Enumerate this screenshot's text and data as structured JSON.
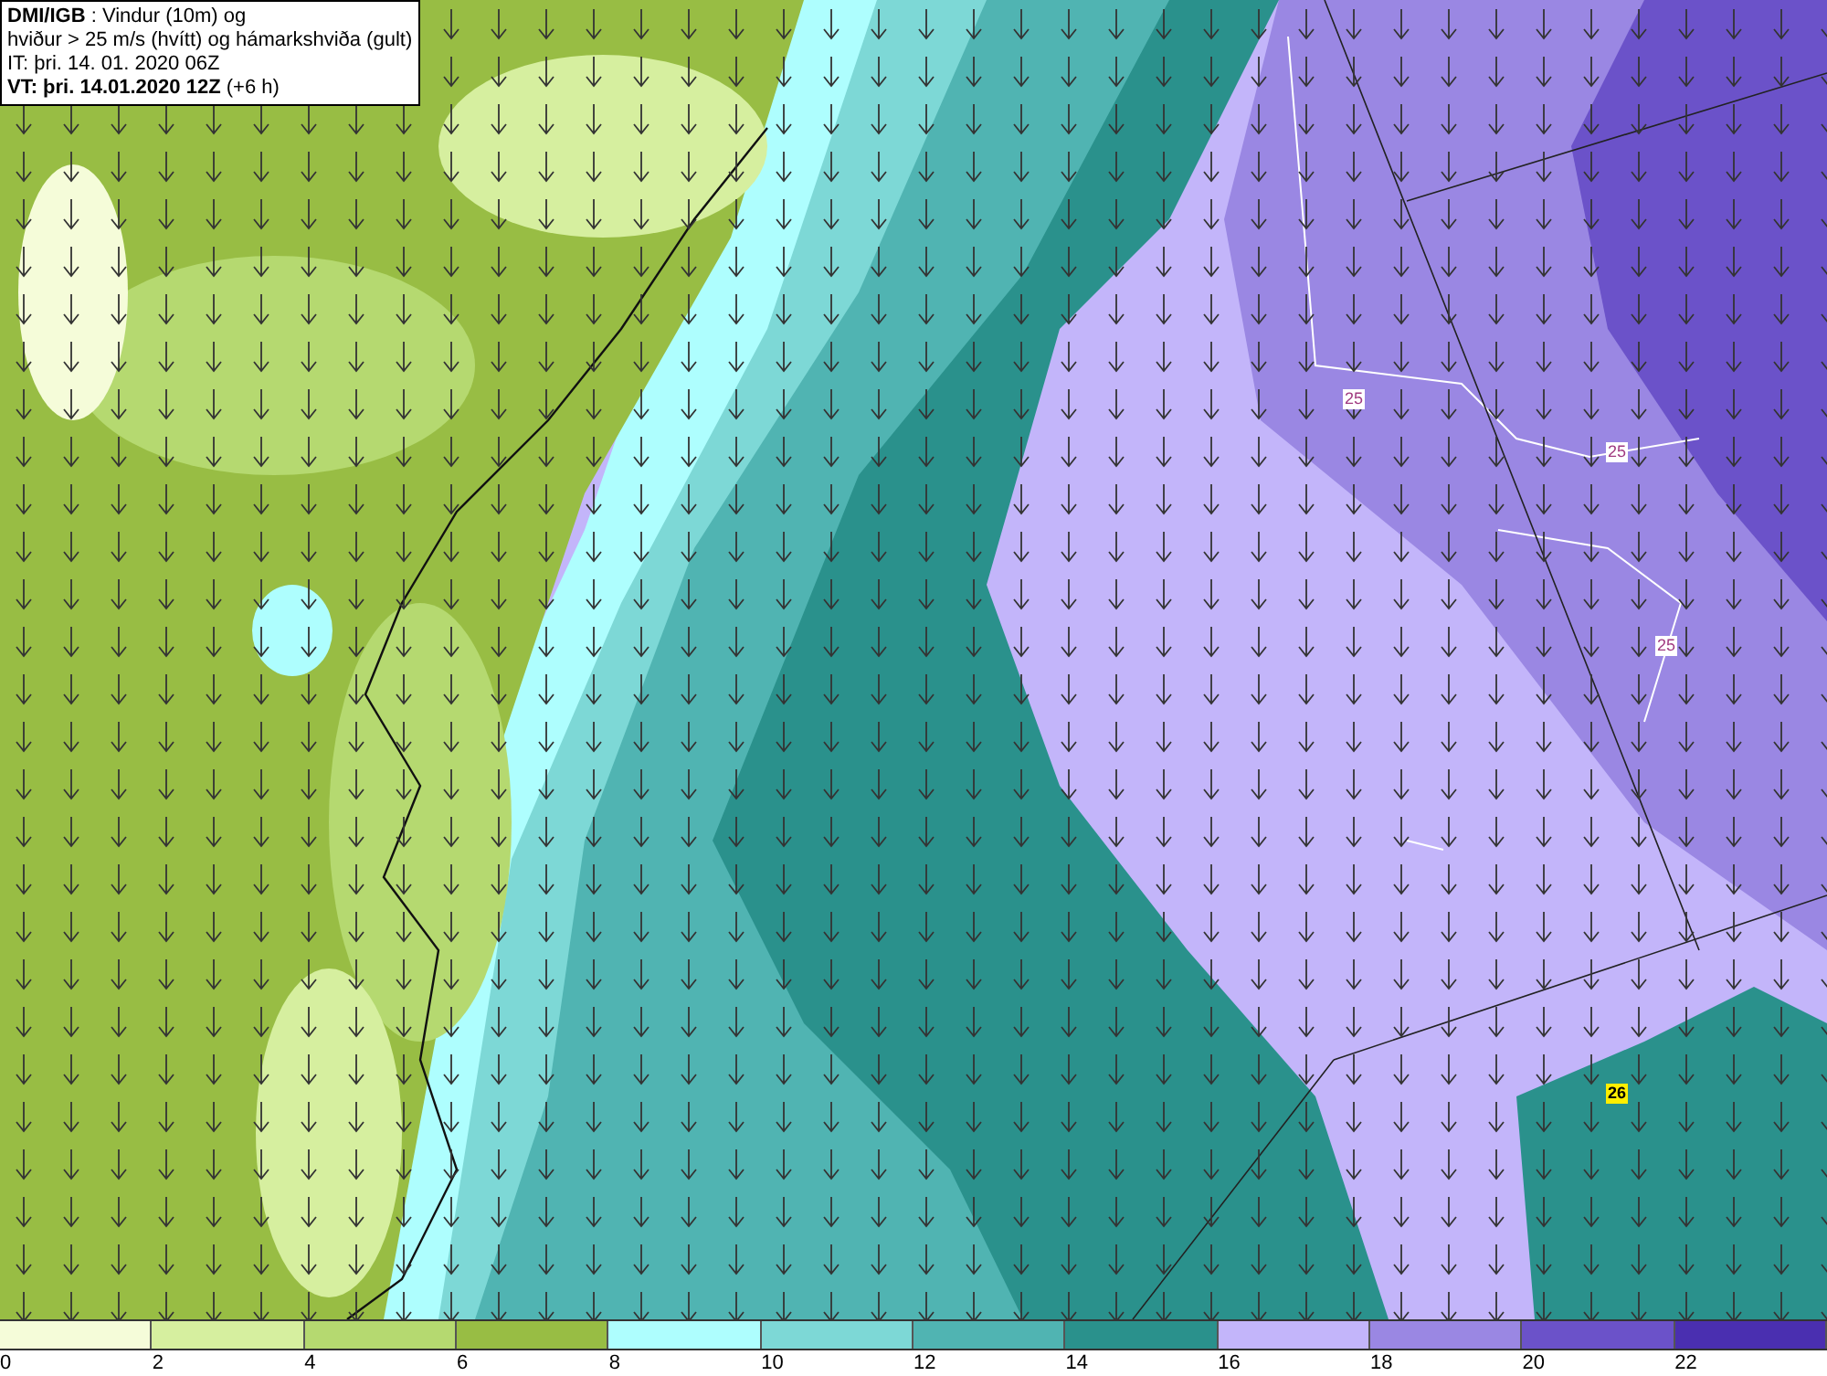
{
  "title_box": {
    "lines": [
      "**DMI/IGB** : Vindur (10m) og",
      "hviður > 25 m/s (hvítt) og hámarkshviða (gult)",
      "IT: þri. 14. 01. 2020 06Z",
      "**VT: þri. 14.01.2020 12Z** (+6 h)"
    ]
  },
  "map": {
    "contour_labels": [
      {
        "text": "25",
        "kind": "gust"
      },
      {
        "text": "25",
        "kind": "gust"
      },
      {
        "text": "25",
        "kind": "gust"
      },
      {
        "text": "26",
        "kind": "max"
      }
    ]
  },
  "legend": {
    "bins": [
      {
        "label": "0",
        "color": "#f5fcd9"
      },
      {
        "label": "2",
        "color": "#d6ef9f"
      },
      {
        "label": "4",
        "color": "#b5d970"
      },
      {
        "label": "6",
        "color": "#98bd44"
      },
      {
        "label": "8",
        "color": "#aefefe"
      },
      {
        "label": "10",
        "color": "#7dd8d6"
      },
      {
        "label": "12",
        "color": "#50b4b2"
      },
      {
        "label": "14",
        "color": "#2a918c"
      },
      {
        "label": "16",
        "color": "#c3b5fa"
      },
      {
        "label": "18",
        "color": "#9a87e3"
      },
      {
        "label": "20",
        "color": "#6b52c9"
      },
      {
        "label": "22",
        "color": "#4a2fb0"
      }
    ]
  }
}
